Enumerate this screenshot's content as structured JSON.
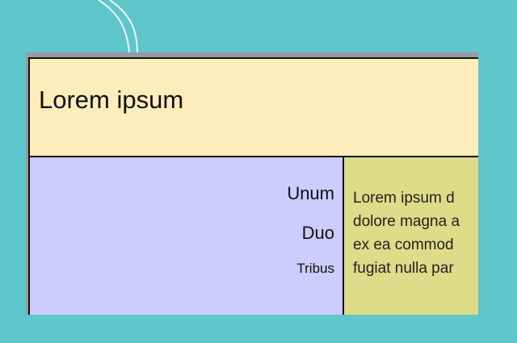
{
  "header": {
    "title": "Lorem ipsum"
  },
  "nav": {
    "items": [
      {
        "label": "Unum"
      },
      {
        "label": "Duo"
      },
      {
        "label": "Tribus"
      }
    ]
  },
  "content": {
    "lines": [
      "Lorem ipsum d",
      "dolore magna a",
      "ex ea commod",
      "fugiat nulla par"
    ]
  },
  "colors": {
    "background": "#5fc6cb",
    "header_bg": "#fdedbb",
    "nav_bg": "#ccccfd",
    "content_bg": "#dddc88"
  }
}
